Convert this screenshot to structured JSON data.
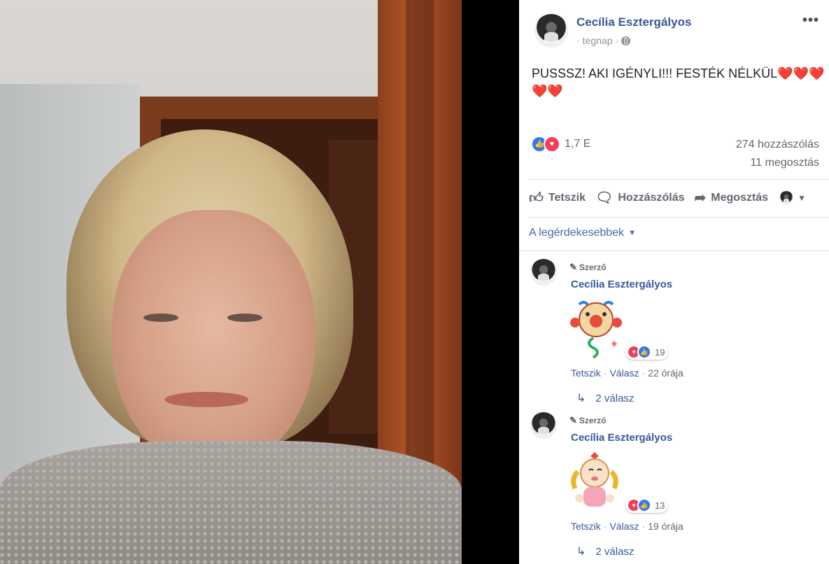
{
  "post": {
    "author": "Cecília Esztergályos",
    "time": "tegnap",
    "separator": "·",
    "more_label": "•••",
    "text": "PUSSSZ! AKI IGÉNYLI!!! FESTÉK NÉLKÜL❤️❤️❤️❤️❤️",
    "reactions_count": "1,7 E",
    "reaction_types": [
      "like",
      "love"
    ],
    "comments_count": "274 hozzászólás",
    "shares_count": "11 megosztás"
  },
  "actions": {
    "like": "Tetszik",
    "comment": "Hozzászólás",
    "share": "Megosztás"
  },
  "sort_label": "A legérdekesebbek",
  "comments": [
    {
      "badge": "Szerző",
      "author": "Cecília Esztergályos",
      "sticker": "candy-crush-character-sticker",
      "reaction_count": "19",
      "like": "Tetszik",
      "reply": "Válasz",
      "time": "22 órája",
      "replies": "2 válasz"
    },
    {
      "badge": "Szerző",
      "author": "Cecília Esztergályos",
      "sticker": "candy-girl-sticker",
      "reaction_count": "13",
      "like": "Tetszik",
      "reply": "Válasz",
      "time": "19 órája",
      "replies": "2 válasz"
    }
  ],
  "colors": {
    "link": "#385898",
    "like_blue": "#2f78f6",
    "love_red": "#f33e58",
    "secondary_text": "#606770"
  }
}
